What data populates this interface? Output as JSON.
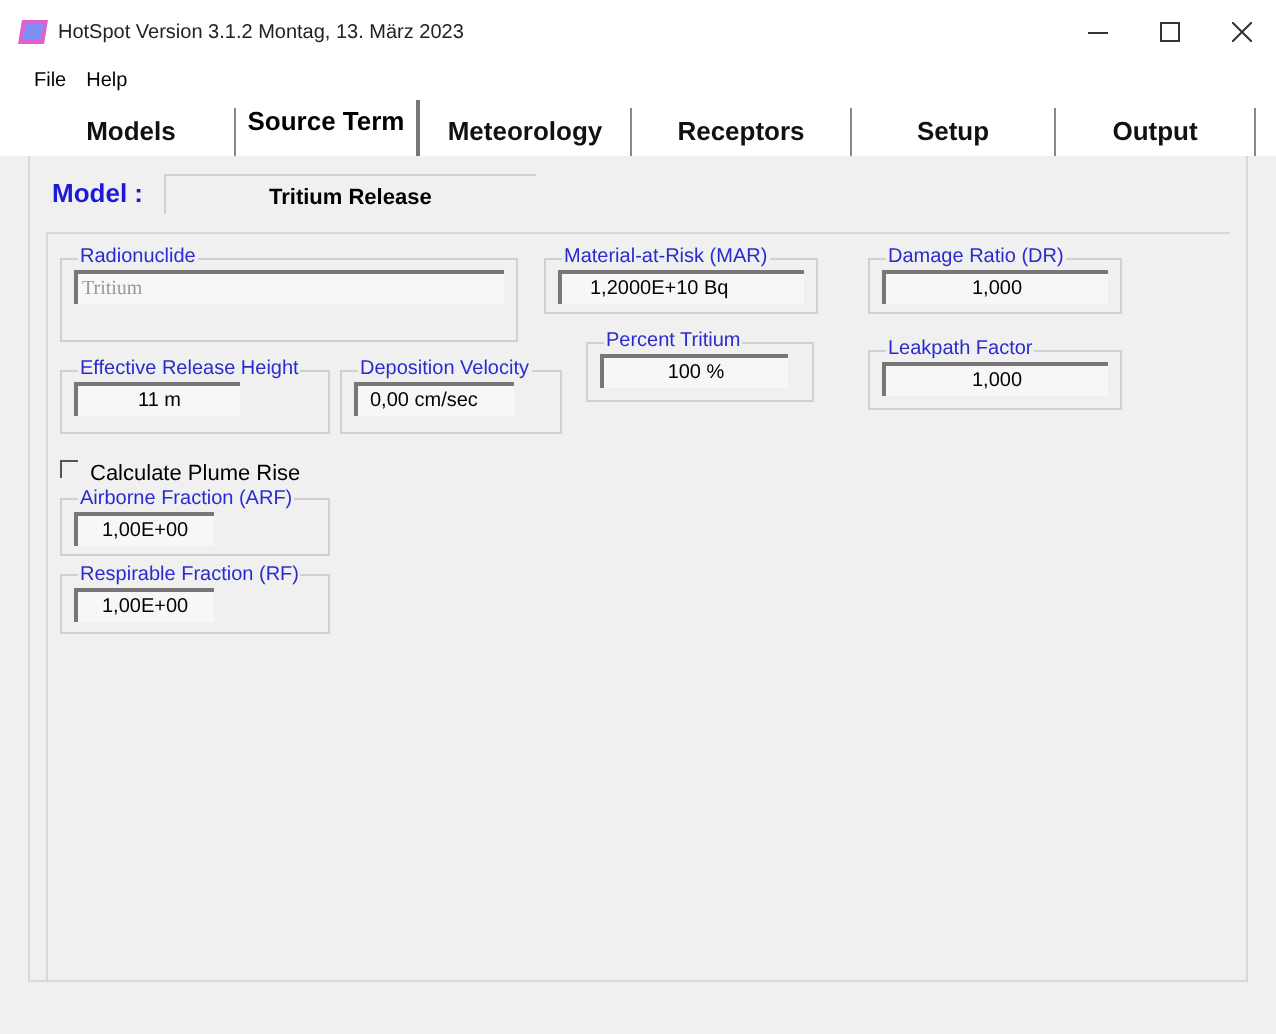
{
  "window": {
    "title": "HotSpot Version 3.1.2 Montag, 13. März 2023"
  },
  "menu": [
    "File",
    "Help"
  ],
  "tabs": [
    {
      "label": "Models",
      "selected": false
    },
    {
      "label": "Source Term",
      "selected": true
    },
    {
      "label": "Meteorology",
      "selected": false
    },
    {
      "label": "Receptors",
      "selected": false
    },
    {
      "label": "Setup",
      "selected": false
    },
    {
      "label": "Output",
      "selected": false
    }
  ],
  "model": {
    "label": "Model :",
    "value": "Tritium Release"
  },
  "fields": [
    {
      "label": "Radionuclide",
      "value": "Tritium",
      "disabled": true
    },
    {
      "label": "Effective Release Height",
      "value": "11 m",
      "disabled": false
    },
    {
      "label": "Deposition Velocity",
      "value": "0,00 cm/sec",
      "disabled": false
    },
    {
      "label": "Material-at-Risk (MAR)",
      "value": "1,2000E+10 Bq",
      "disabled": false
    },
    {
      "label": "Percent Tritium",
      "value": "100 %",
      "disabled": false
    },
    {
      "label": "Damage Ratio (DR)",
      "value": "1,000",
      "disabled": false
    },
    {
      "label": "Leakpath Factor",
      "value": "1,000",
      "disabled": false
    },
    {
      "label": "Airborne Fraction (ARF)",
      "value": "1,00E+00",
      "disabled": false
    },
    {
      "label": "Respirable Fraction (RF)",
      "value": "1,00E+00",
      "disabled": false
    }
  ],
  "plume_rise": {
    "label": "Calculate Plume Rise",
    "checked": false
  }
}
